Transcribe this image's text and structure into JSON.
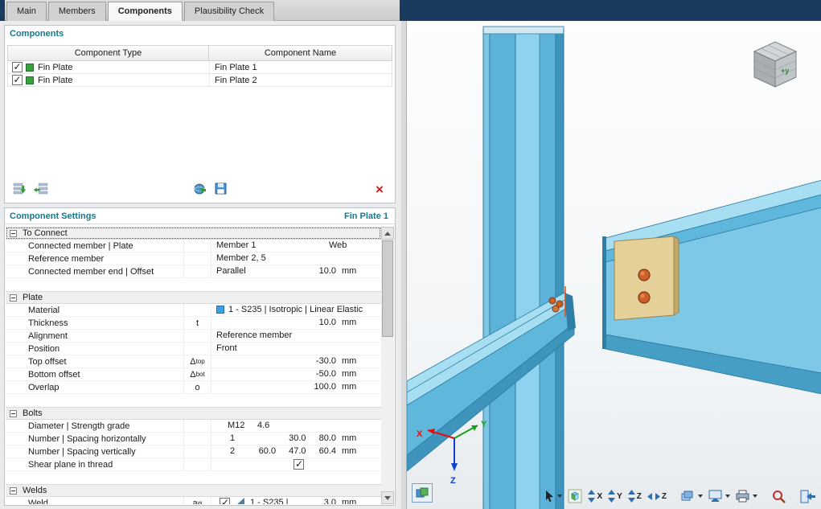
{
  "tabs": {
    "items": [
      {
        "label": "Main"
      },
      {
        "label": "Members"
      },
      {
        "label": "Components"
      },
      {
        "label": "Plausibility Check"
      }
    ],
    "active_index": 2
  },
  "components": {
    "title": "Components",
    "columns": [
      "Component Type",
      "Component Name"
    ],
    "rows": [
      {
        "checked": true,
        "type": "Fin Plate",
        "name": "Fin Plate 1"
      },
      {
        "checked": true,
        "type": "Fin Plate",
        "name": "Fin Plate 2"
      }
    ]
  },
  "settings": {
    "title": "Component Settings",
    "selected": "Fin Plate 1",
    "to_connect": {
      "label": "To Connect",
      "rows": {
        "connected_member": {
          "label": "Connected member | Plate",
          "v1": "Member 1",
          "v2": "Web"
        },
        "reference_member": {
          "label": "Reference member",
          "v1": "Member 2, 5"
        },
        "member_end": {
          "label": "Connected member end | Offset",
          "v1": "Parallel",
          "num": "10.0",
          "unit": "mm"
        }
      }
    },
    "plate": {
      "label": "Plate",
      "rows": {
        "material": {
          "label": "Material",
          "value": "1 - S235 | Isotropic | Linear Elastic",
          "swatch_color": "#3da0e0"
        },
        "thickness": {
          "label": "Thickness",
          "sym": "t",
          "num": "10.0",
          "unit": "mm"
        },
        "alignment": {
          "label": "Alignment",
          "value": "Reference member"
        },
        "position": {
          "label": "Position",
          "value": "Front"
        },
        "top_offset": {
          "label": "Top offset",
          "sym": "Δ",
          "sym_sub": "top",
          "num": "-30.0",
          "unit": "mm"
        },
        "bottom_offset": {
          "label": "Bottom offset",
          "sym": "Δ",
          "sym_sub": "bot",
          "num": "-50.0",
          "unit": "mm"
        },
        "overlap": {
          "label": "Overlap",
          "sym": "o",
          "num": "100.0",
          "unit": "mm"
        }
      }
    },
    "bolts": {
      "label": "Bolts",
      "rows": {
        "diameter": {
          "label": "Diameter | Strength grade",
          "v1": "M12",
          "v2": "4.6"
        },
        "horizontal": {
          "label": "Number | Spacing horizontally",
          "count": "1",
          "nums": "30.0 80.0",
          "unit": "mm"
        },
        "vertical": {
          "label": "Number | Spacing vertically",
          "count": "2",
          "nums": "60.0 47.0 60.4",
          "unit": "mm"
        },
        "shear": {
          "label": "Shear plane in thread",
          "checked": true
        }
      }
    },
    "welds": {
      "label": "Welds",
      "rows": {
        "weld": {
          "label": "Weld",
          "sym": "a",
          "sym_sub": "w",
          "checked": true,
          "value": "1 - S235 |",
          "num": "3.0",
          "unit": "mm"
        }
      }
    }
  },
  "viewport": {
    "axes": {
      "x": "X",
      "y": "Y",
      "z": "Z"
    },
    "nav_cube": {
      "front_label": "+y"
    }
  },
  "viewport_toolbar": {
    "axis_labels": [
      "X",
      "Y",
      "Z",
      "Z"
    ]
  },
  "icons": {
    "delete_glyph": "×",
    "checkbox_check_glyph": "✓"
  },
  "colors": {
    "header_teal": "#16798a",
    "top_navy": "#1b3a5f",
    "beam_blue": "#7cc8e6",
    "plate_tan": "#e6d09a",
    "bolt_orange": "#cf5f28"
  }
}
